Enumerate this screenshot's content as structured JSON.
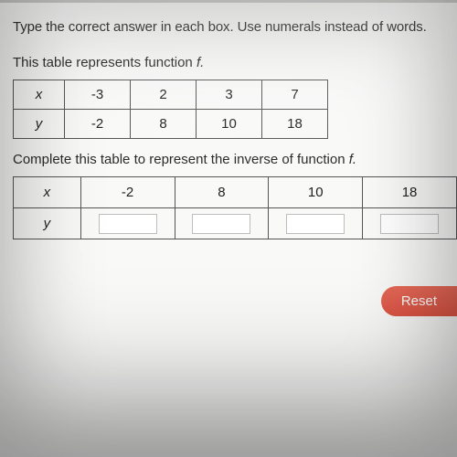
{
  "instruction": "Type the correct answer in each box. Use numerals instead of words.",
  "line1_prefix": "This table represents function ",
  "fn_name": "f.",
  "table1": {
    "row_x_label": "x",
    "row_y_label": "y",
    "x": [
      "-3",
      "2",
      "3",
      "7"
    ],
    "y": [
      "-2",
      "8",
      "10",
      "18"
    ]
  },
  "line2_prefix": "Complete this table to represent the inverse of function ",
  "fn_name2": "f.",
  "table2": {
    "row_x_label": "x",
    "row_y_label": "y",
    "x": [
      "-2",
      "8",
      "10",
      "18"
    ]
  },
  "reset_label": "Reset",
  "chart_data": [
    {
      "type": "table",
      "title": "Function f",
      "columns": [
        "x",
        "y"
      ],
      "rows": [
        {
          "x": -3,
          "y": -2
        },
        {
          "x": 2,
          "y": 8
        },
        {
          "x": 3,
          "y": 10
        },
        {
          "x": 7,
          "y": 18
        }
      ]
    },
    {
      "type": "table",
      "title": "Inverse of function f (to complete)",
      "columns": [
        "x",
        "y"
      ],
      "rows": [
        {
          "x": -2,
          "y": null
        },
        {
          "x": 8,
          "y": null
        },
        {
          "x": 10,
          "y": null
        },
        {
          "x": 18,
          "y": null
        }
      ]
    }
  ]
}
